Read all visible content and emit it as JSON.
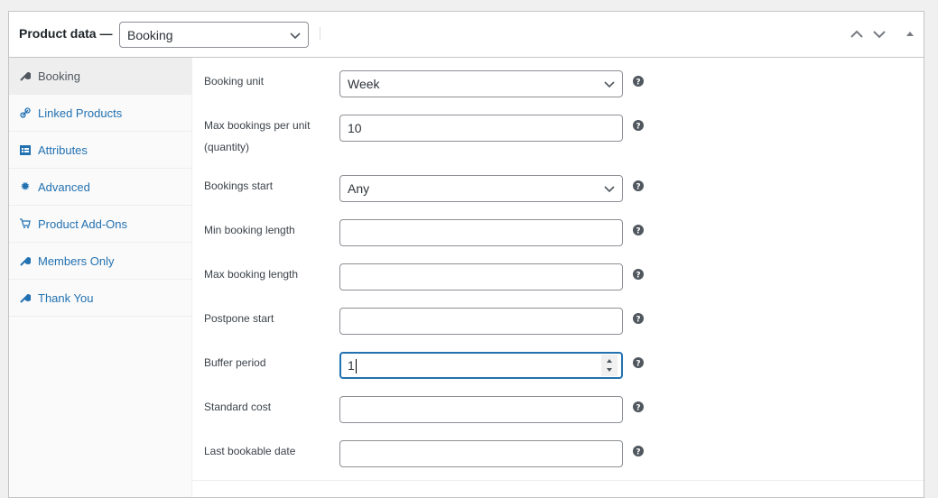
{
  "header": {
    "title": "Product data —",
    "product_type": "Booking",
    "icons": [
      "chevron-up-icon",
      "chevron-down-icon",
      "triangle-up-icon"
    ]
  },
  "sidebar": {
    "items": [
      {
        "label": "Booking",
        "icon": "wrench-icon",
        "active": true
      },
      {
        "label": "Linked Products",
        "icon": "link-icon",
        "active": false
      },
      {
        "label": "Attributes",
        "icon": "list-card-icon",
        "active": false
      },
      {
        "label": "Advanced",
        "icon": "gear-icon",
        "active": false
      },
      {
        "label": "Product Add-Ons",
        "icon": "cart-icon",
        "active": false
      },
      {
        "label": "Members Only",
        "icon": "wrench-icon",
        "active": false
      },
      {
        "label": "Thank You",
        "icon": "wrench-icon",
        "active": false
      }
    ]
  },
  "fields": [
    {
      "label": "Booking unit",
      "type": "select",
      "value": "Week"
    },
    {
      "label": "Max bookings per unit (quantity)",
      "type": "text",
      "value": "10"
    },
    {
      "label": "Bookings start",
      "type": "select",
      "value": "Any"
    },
    {
      "label": "Min booking length",
      "type": "text",
      "value": ""
    },
    {
      "label": "Max booking length",
      "type": "text",
      "value": ""
    },
    {
      "label": "Postpone start",
      "type": "text",
      "value": ""
    },
    {
      "label": "Buffer period",
      "type": "number",
      "value": "1",
      "focused": true
    },
    {
      "label": "Standard cost",
      "type": "text",
      "value": ""
    },
    {
      "label": "Last bookable date",
      "type": "text",
      "value": ""
    }
  ],
  "colors": {
    "accent": "#2271b1",
    "active_tab_bg": "#eeeeee",
    "help_icon": "#50575e"
  }
}
